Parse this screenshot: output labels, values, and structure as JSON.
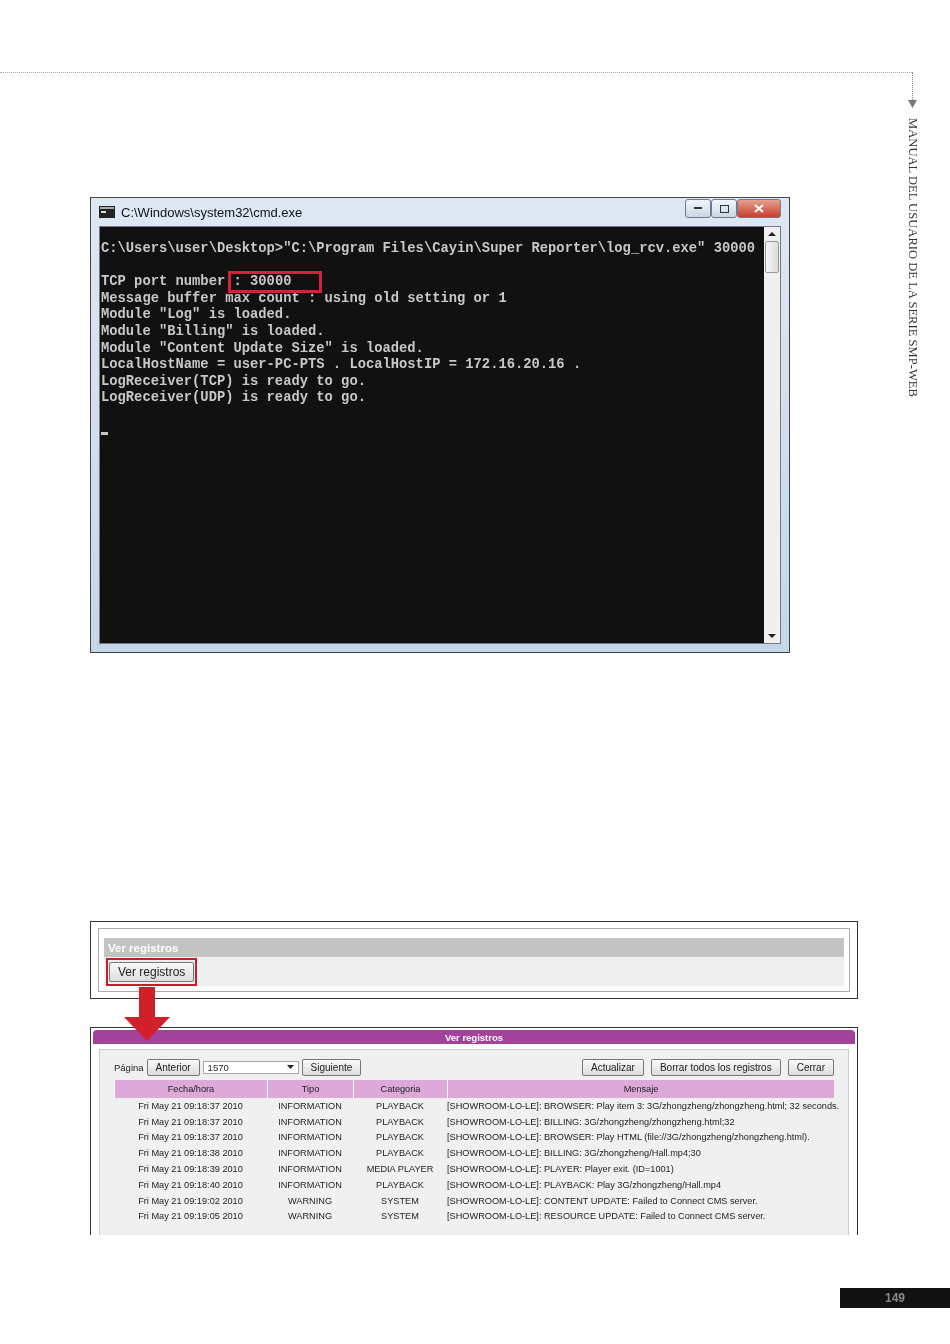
{
  "side_header": "MANUAL DEL USUARIO DE LA SERIE SMP-WEB",
  "console_window": {
    "title": "C:\\Windows\\system32\\cmd.exe",
    "lines": [
      {
        "kind": "text",
        "text": "C:\\Users\\user\\Desktop>\"C:\\Program Files\\Cayin\\Super Reporter\\log_rcv.exe\" 30000"
      },
      {
        "kind": "blank"
      },
      {
        "kind": "text",
        "text": "TCP port number",
        "highlight": ": 30000"
      },
      {
        "kind": "text",
        "text": "Message buffer max count : using old setting or 1"
      },
      {
        "kind": "text",
        "text": "Module \"Log\" is loaded."
      },
      {
        "kind": "text",
        "text": "Module \"Billing\" is loaded."
      },
      {
        "kind": "text",
        "text": "Module \"Content Update Size\" is loaded."
      },
      {
        "kind": "text",
        "text": "LocalHostName = user-PC-PTS . LocalHostIP = 172.16.20.16 ."
      },
      {
        "kind": "text",
        "text": "LogReceiver(TCP) is ready to go."
      },
      {
        "kind": "text",
        "text": "LogReceiver(UDP) is ready to go."
      },
      {
        "kind": "blank"
      },
      {
        "kind": "cursor"
      }
    ]
  },
  "log_button_panel": {
    "title": "Ver registros",
    "button": {
      "label": "Ver registros",
      "highlighted": true
    }
  },
  "log_viewer": {
    "title": "Ver registros",
    "page_label": "Página",
    "prev_button": "Anterior",
    "page_select": "1570",
    "next_button": "Siguiente",
    "actions": [
      "Actualizar",
      "Borrar todos los registros",
      "Cerrar"
    ],
    "columns": [
      "Fecha/hora",
      "Tipo",
      "Categoria",
      "Mensaje"
    ],
    "rows": [
      [
        "Fri May 21 09:18:37 2010",
        "INFORMATION",
        "PLAYBACK",
        "[SHOWROOM-LO-LE]: BROWSER: Play item 3: 3G/zhongzheng/zhongzheng.html; 32 seconds."
      ],
      [
        "Fri May 21 09:18:37 2010",
        "INFORMATION",
        "PLAYBACK",
        "[SHOWROOM-LO-LE]: BILLING: 3G/zhongzheng/zhongzheng.html;32"
      ],
      [
        "Fri May 21 09:18:37 2010",
        "INFORMATION",
        "PLAYBACK",
        "[SHOWROOM-LO-LE]: BROWSER: Play HTML (file://3G/zhongzheng/zhongzheng.html)."
      ],
      [
        "Fri May 21 09:18:38 2010",
        "INFORMATION",
        "PLAYBACK",
        "[SHOWROOM-LO-LE]: BILLING: 3G/zhongzheng/Hall.mp4;30"
      ],
      [
        "Fri May 21 09:18:39 2010",
        "INFORMATION",
        "MEDIA PLAYER",
        "[SHOWROOM-LO-LE]: PLAYER: Player exit. (ID=1001)"
      ],
      [
        "Fri May 21 09:18:40 2010",
        "INFORMATION",
        "PLAYBACK",
        "[SHOWROOM-LO-LE]: PLAYBACK: Play 3G/zhongzheng/Hall.mp4"
      ],
      [
        "Fri May 21 09:19:02 2010",
        "WARNING",
        "SYSTEM",
        "[SHOWROOM-LO-LE]: CONTENT UPDATE: Failed to Connect CMS server."
      ],
      [
        "Fri May 21 09:19:05 2010",
        "WARNING",
        "SYSTEM",
        "[SHOWROOM-LO-LE]: RESOURCE UPDATE: Failed to Connect CMS server."
      ]
    ]
  },
  "page_number": "149"
}
